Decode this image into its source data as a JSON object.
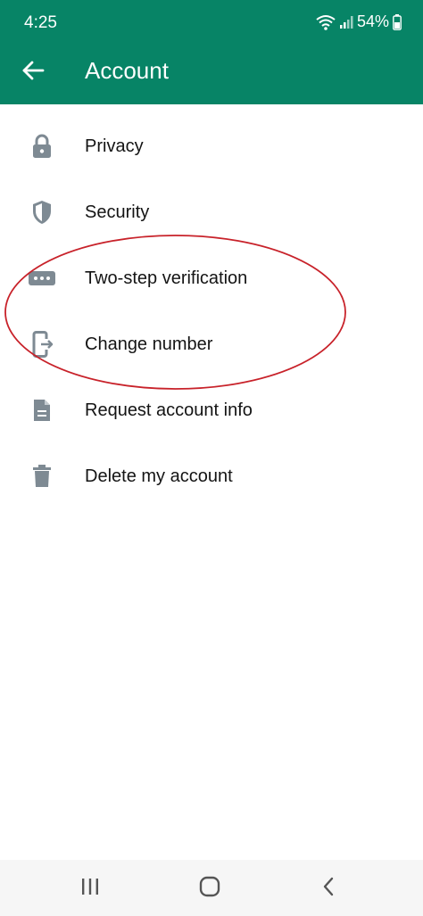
{
  "status_bar": {
    "time": "4:25",
    "battery": "54%",
    "icons": [
      "wifi-icon",
      "signal-icon",
      "battery-icon"
    ]
  },
  "header": {
    "title": "Account",
    "back_icon": "arrow-back-icon",
    "background_color": "#078466"
  },
  "menu": {
    "items": [
      {
        "label": "Privacy",
        "icon": "lock-icon"
      },
      {
        "label": "Security",
        "icon": "shield-icon"
      },
      {
        "label": "Two-step verification",
        "icon": "password-dots-icon"
      },
      {
        "label": "Change number",
        "icon": "phone-change-icon"
      },
      {
        "label": "Request account info",
        "icon": "document-icon"
      },
      {
        "label": "Delete my account",
        "icon": "trash-icon"
      }
    ]
  },
  "annotation": {
    "color": "#c8222a",
    "circled_items": [
      "Two-step verification",
      "Change number"
    ]
  },
  "navbar": {
    "icons": [
      "recent-apps-icon",
      "home-icon",
      "back-nav-icon"
    ]
  }
}
